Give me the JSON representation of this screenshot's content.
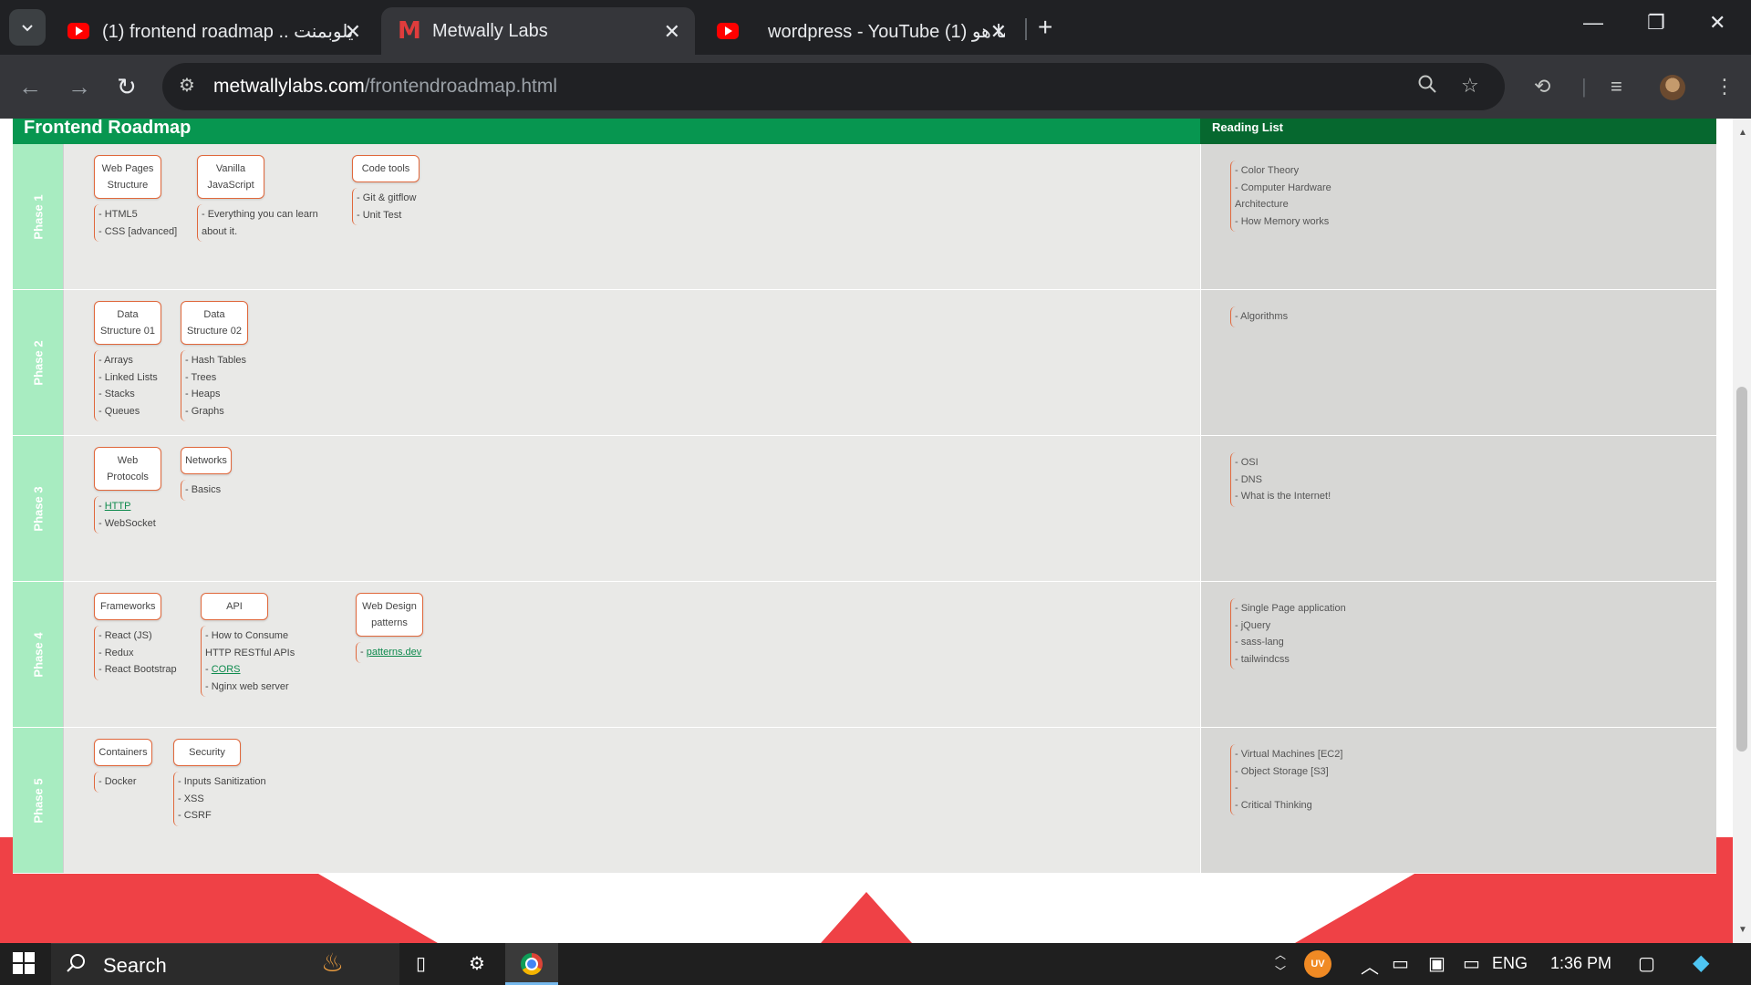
{
  "browser": {
    "tabs": [
      {
        "title": "(1) frontend roadmap .. يلوبمنت",
        "icon": "youtube-icon",
        "active": false
      },
      {
        "title": "Metwally Labs",
        "icon": "metwally-m-icon",
        "active": true
      },
      {
        "title": "wordpress - YouTube ما هو (1)",
        "icon": "youtube-icon",
        "active": false
      }
    ],
    "url_host": "metwallylabs.com",
    "url_path": "/frontendroadmap.html"
  },
  "page": {
    "title": "Frontend Roadmap",
    "reading_title": "Reading List",
    "phases": [
      {
        "label": "Phase 1",
        "topics": [
          {
            "title": "Web Pages Structure",
            "items": [
              "- HTML5",
              "- CSS [advanced]"
            ]
          },
          {
            "title": "Vanilla JavaScript",
            "items": [
              "- Everything you can learn about it."
            ]
          },
          {
            "title": "Code tools",
            "items": [
              "- Git & gitflow",
              "- Unit Test"
            ]
          }
        ],
        "reading": [
          "- Color Theory",
          "- Computer Hardware Architecture",
          "- How Memory works"
        ]
      },
      {
        "label": "Phase 2",
        "topics": [
          {
            "title": "Data Structure 01",
            "items": [
              "- Arrays",
              "- Linked Lists",
              "- Stacks",
              "- Queues"
            ]
          },
          {
            "title": "Data Structure 02",
            "items": [
              "- Hash Tables",
              "- Trees",
              "- Heaps",
              "- Graphs"
            ]
          }
        ],
        "reading": [
          "- Algorithms"
        ]
      },
      {
        "label": "Phase 3",
        "topics": [
          {
            "title": "Web Protocols",
            "items": [
              "HTTP",
              "- WebSocket"
            ]
          },
          {
            "title": "Networks",
            "items": [
              "- Basics"
            ]
          }
        ],
        "reading": [
          "- OSI",
          "- DNS",
          "- What is the Internet!"
        ]
      },
      {
        "label": "Phase 4",
        "topics": [
          {
            "title": "Frameworks",
            "items": [
              "- React (JS)",
              "- Redux",
              "- React Bootstrap"
            ]
          },
          {
            "title": "API",
            "items": [
              "- How to Consume HTTP RESTful APIs",
              "CORS",
              "- Nginx web server"
            ]
          },
          {
            "title": "Web Design patterns",
            "items": [
              "patterns.dev"
            ]
          }
        ],
        "reading": [
          "- Single Page application",
          "- jQuery",
          "- sass-lang",
          "- tailwindcss"
        ]
      },
      {
        "label": "Phase 5",
        "topics": [
          {
            "title": "Containers",
            "items": [
              "- Docker"
            ]
          },
          {
            "title": "Security",
            "items": [
              "- Inputs Sanitization",
              "- XSS",
              "- CSRF"
            ]
          }
        ],
        "reading": [
          "- Virtual Machines [EC2]",
          "- Object Storage [S3]",
          "-",
          "- Critical Thinking"
        ]
      }
    ]
  },
  "taskbar": {
    "search_placeholder": "Search",
    "tray_badge": "UV",
    "language": "ENG",
    "time": "1:36 PM"
  },
  "colors": {
    "green": "#079650",
    "dark_green": "#06682f",
    "accent": "#e0683c",
    "red": "#ef4146"
  }
}
